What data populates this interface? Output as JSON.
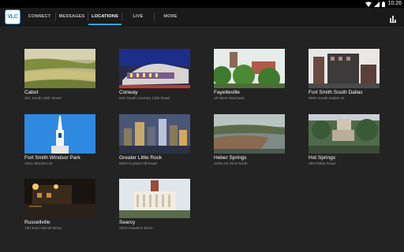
{
  "status_bar": {
    "time": "10:26",
    "icons": [
      "wifi-icon",
      "signal-icon",
      "battery-icon"
    ]
  },
  "app": {
    "logo_text": "VLC"
  },
  "tabs": [
    {
      "label": "CONNECT",
      "active": false
    },
    {
      "label": "MESSAGES",
      "active": false
    },
    {
      "label": "LOCATIONS",
      "active": true
    },
    {
      "label": "LIVE",
      "active": false
    },
    {
      "label": "MORE",
      "active": false
    }
  ],
  "toolbar": {
    "icon": "bar-chart-icon"
  },
  "colors": {
    "accent": "#2fa8e0",
    "background": "#232323",
    "app_bar": "#1a1a1a"
  },
  "locations": [
    {
      "name": "Cabot",
      "address": "201 South 10th Street"
    },
    {
      "name": "Conway",
      "address": "632 South Country Club Road"
    },
    {
      "name": "Fayetteville",
      "address": "15 West Mountain"
    },
    {
      "name": "Fort Smith South Dallas",
      "address": "9000 South Dallas St"
    },
    {
      "name": "Fort Smith Windsor Park",
      "address": "4201 Windsor Dr"
    },
    {
      "name": "Greater Little Rock",
      "address": "8000 Crystal Hill Road"
    },
    {
      "name": "Heber Springs",
      "address": "1005 AR 25 B North"
    },
    {
      "name": "Hot Springs",
      "address": "300 Pakis Road"
    },
    {
      "name": "Russellville",
      "address": "130 East Harrell Drive"
    },
    {
      "name": "Searcy",
      "address": "2923 Hawkins Drive"
    }
  ]
}
